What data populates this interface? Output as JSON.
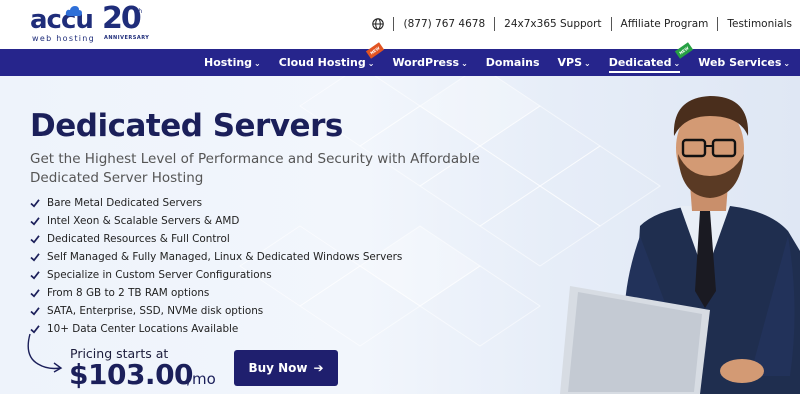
{
  "brand": {
    "logo_word": "accu",
    "logo_sub": "web hosting",
    "anniversary_number": "20",
    "anniversary_suffix": "th",
    "anniversary_label": "ANNIVERSARY"
  },
  "topbar": {
    "globe_icon": "globe-icon",
    "phone": "(877) 767 4678",
    "support": "24x7x365 Support",
    "affiliate": "Affiliate Program",
    "testimonials": "Testimonials"
  },
  "nav": {
    "items": [
      {
        "label": "Hosting",
        "chevron": "⌄"
      },
      {
        "label": "Cloud Hosting",
        "chevron": "⌄",
        "badge": "NEW"
      },
      {
        "label": "WordPress",
        "chevron": "⌄"
      },
      {
        "label": "Domains",
        "chevron": ""
      },
      {
        "label": "VPS",
        "chevron": "⌄"
      },
      {
        "label": "Dedicated",
        "chevron": "⌄",
        "badge": "NEW",
        "active": true
      },
      {
        "label": "Web Services",
        "chevron": "⌄"
      }
    ]
  },
  "hero": {
    "title": "Dedicated Servers",
    "subtitle": "Get the Highest Level of Performance and Security with Affordable Dedicated Server Hosting",
    "features": [
      "Bare Metal Dedicated Servers",
      "Intel Xeon & Scalable Servers & AMD",
      "Dedicated Resources & Full Control",
      "Self Managed & Fully Managed, Linux & Dedicated Windows Servers",
      "Specialize in Custom Server Configurations",
      "From 8 GB to 2 TB RAM options",
      "SATA, Enterprise, SSD, NVMe disk options",
      "10+ Data Center Locations Available"
    ],
    "pricing_label": "Pricing starts at",
    "price": "$103.00",
    "per": "/mo",
    "buy_label": "Buy Now",
    "buy_arrow": "➔"
  },
  "colors": {
    "brand_navy": "#1b1f5a",
    "nav_bg": "#26258c",
    "button_bg": "#1f1f6e"
  }
}
